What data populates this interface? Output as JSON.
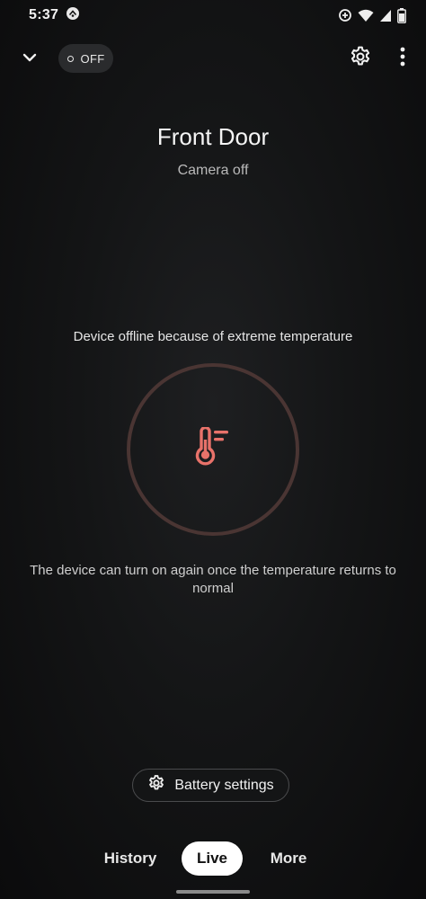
{
  "status_bar": {
    "time": "5:37",
    "icons": [
      "nest-app-icon",
      "data-saver-icon",
      "wifi-icon",
      "signal-icon",
      "battery-icon"
    ]
  },
  "top_bar": {
    "toggle_label": "OFF",
    "icons": [
      "chevron-down-icon",
      "gear-icon",
      "more-vert-icon"
    ]
  },
  "device": {
    "name": "Front Door",
    "status": "Camera off"
  },
  "offline": {
    "message": "Device offline because of extreme temperature",
    "recovery": "The device can turn on again once the temperature returns to normal",
    "icon": "thermometer-icon",
    "icon_color": "#e8726a",
    "ring_color": "#4a3533"
  },
  "battery_button": {
    "label": "Battery settings"
  },
  "bottom_nav": {
    "tabs": [
      {
        "label": "History",
        "active": false
      },
      {
        "label": "Live",
        "active": true
      },
      {
        "label": "More",
        "active": false
      }
    ]
  }
}
